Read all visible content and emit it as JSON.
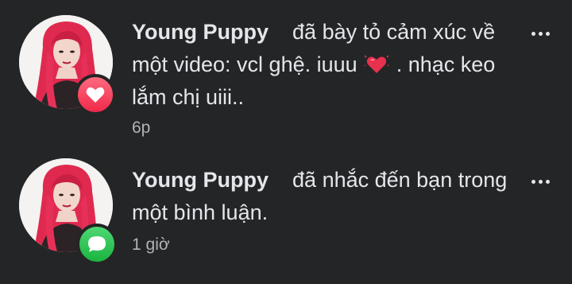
{
  "notifications": [
    {
      "actor": "Young Puppy",
      "line1": "đã bày tỏ cảm xúc về",
      "line2_before_emoji": "một video: vcl ghệ. iuuu",
      "emoji": "beating-heart-icon",
      "line2_after_emoji": ". nhạc keo",
      "line3": "lắm chị uiii..",
      "time": "6p",
      "badge": "heart-icon",
      "badge_color": "#f0284a"
    },
    {
      "actor": "Young Puppy",
      "line1": "đã nhắc đến bạn trong",
      "line2": "một bình luận.",
      "time": "1 giờ",
      "badge": "comment-icon",
      "badge_color": "#1bb33f"
    }
  ],
  "more_icon": "more-horizontal-icon",
  "colors": {
    "background": "#242526",
    "primary_text": "#e4e6eb",
    "secondary_text": "#b0b3b8"
  }
}
